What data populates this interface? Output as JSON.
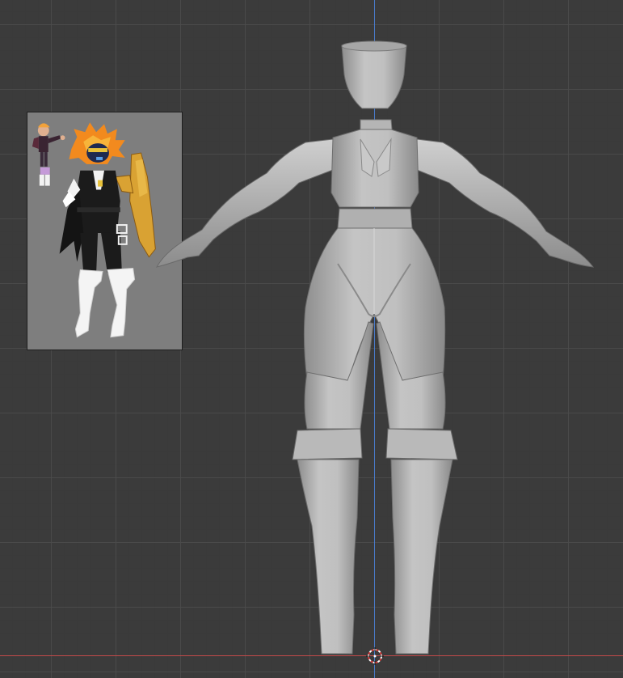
{
  "viewport": {
    "background_color": "#3b3b3b",
    "grid_color": "#4b4b4b",
    "axis_z_color": "#4a7ac9",
    "axis_x_color": "#c24a4a"
  },
  "reference_image": {
    "background_color": "#7e7e7e",
    "accent_colors": [
      "#f28a1e",
      "#1b1b1b",
      "#ffffff",
      "#d9a233",
      "#2a5aa8"
    ]
  },
  "model": {
    "mesh_color": "#b8b8b8"
  },
  "icons": {
    "cursor": "3d-cursor-icon"
  }
}
